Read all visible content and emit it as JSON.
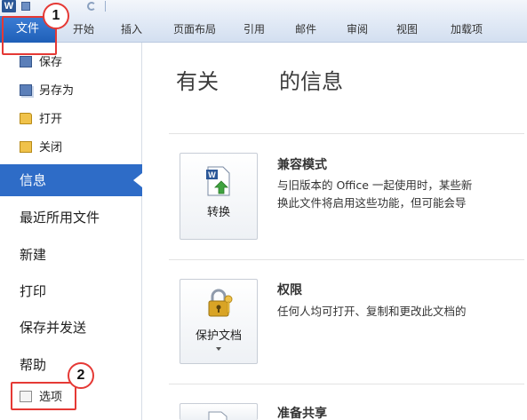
{
  "ribbon": {
    "app_logo": "W",
    "file_tab": "文件",
    "tabs": [
      "开始",
      "插入",
      "页面布局",
      "引用",
      "邮件",
      "审阅",
      "视图",
      "加载项"
    ]
  },
  "callouts": [
    "1",
    "2"
  ],
  "backstage_nav": {
    "small_items": [
      {
        "label": "保存",
        "icon": "save-icon"
      },
      {
        "label": "另存为",
        "icon": "save-as-icon"
      },
      {
        "label": "打开",
        "icon": "open-folder-icon"
      },
      {
        "label": "关闭",
        "icon": "close-folder-icon"
      }
    ],
    "active_item": "信息",
    "big_items": [
      "最近所用文件",
      "新建",
      "打印",
      "保存并发送",
      "帮助"
    ],
    "options_item": {
      "label": "选项",
      "icon": "options-icon"
    }
  },
  "info": {
    "heading_left": "有关",
    "heading_right": "的信息",
    "sections": [
      {
        "button_label": "转换",
        "button_icon": "convert-document-icon",
        "title": "兼容模式",
        "desc_lines": [
          "与旧版本的 Office 一起使用时，某些新",
          "换此文件将启用这些功能，但可能会导"
        ]
      },
      {
        "button_label": "保护文档",
        "button_icon": "lock-key-icon",
        "title": "权限",
        "desc_lines": [
          "任何人均可打开、复制和更改此文档的"
        ]
      },
      {
        "button_label": "",
        "button_icon": "document-icon",
        "title": "准备共享",
        "desc_lines": []
      }
    ]
  },
  "colors": {
    "accent_blue": "#2e6cc7",
    "file_tab_blue": "#1f5fb8",
    "highlight_red": "#e53935"
  }
}
